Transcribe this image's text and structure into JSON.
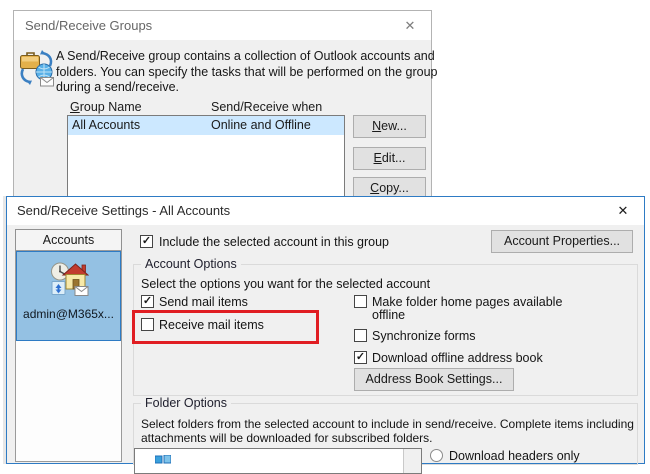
{
  "colors": {
    "highlight_red": "#e01d22",
    "selection_blue": "#cce8ff",
    "tile_blue": "#94c1e3",
    "dialog_border_blue": "#2e7bc4"
  },
  "dialog1": {
    "title": "Send/Receive Groups",
    "close_glyph": "✕",
    "description_lines": [
      "A Send/Receive group contains a collection of Outlook accounts and",
      "folders. You can specify the tasks that will be performed on the group",
      "during a send/receive."
    ],
    "columns": {
      "group_name_mn": "G",
      "group_name_rest": "roup Name",
      "send_receive_when": "Send/Receive when"
    },
    "rows": [
      {
        "name": "All Accounts",
        "when": "Online and Offline"
      }
    ],
    "buttons": {
      "new_mn": "N",
      "new_rest": "ew...",
      "edit_mn": "E",
      "edit_rest": "dit...",
      "copy_mn": "C",
      "copy_rest": "opy..."
    }
  },
  "dialog2": {
    "title": "Send/Receive Settings - All Accounts",
    "close_glyph": "✕",
    "accounts_header": "Accounts",
    "account_name": "admin@M365x...",
    "include_account": {
      "label": "Include the selected account in this group",
      "checked": true
    },
    "account_properties_button": "Account Properties...",
    "account_options": {
      "legend": "Account Options",
      "instruction": "Select the options you want for the selected account",
      "send_mail": {
        "label": "Send mail items",
        "checked": true
      },
      "receive_mail": {
        "label": "Receive mail items",
        "checked": false,
        "highlighted": true
      },
      "home_pages": {
        "label_line1": "Make folder home pages available",
        "label_line2": "offline",
        "checked": false
      },
      "synchronize_forms": {
        "label": "Synchronize forms",
        "checked": false
      },
      "offline_address_book": {
        "label": "Download offline address book",
        "checked": true
      },
      "address_book_button": "Address Book Settings..."
    },
    "folder_options": {
      "legend": "Folder Options",
      "description_lines": [
        "Select folders from the selected account to include in send/receive. Complete items including",
        "attachments will be downloaded for subscribed folders."
      ],
      "partial_option_label": "Download headers only"
    }
  }
}
